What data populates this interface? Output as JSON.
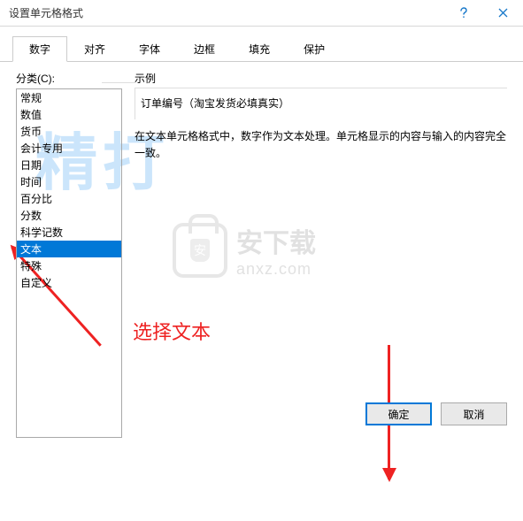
{
  "title": "设置单元格格式",
  "tabs": [
    "数字",
    "对齐",
    "字体",
    "边框",
    "填充",
    "保护"
  ],
  "active_tab": 0,
  "category_label": "分类(C):",
  "categories": [
    "常规",
    "数值",
    "货币",
    "会计专用",
    "日期",
    "时间",
    "百分比",
    "分数",
    "科学记数",
    "文本",
    "特殊",
    "自定义"
  ],
  "selected_index": 9,
  "sample_label": "示例",
  "sample_value": "订单编号（淘宝发货必填真实）",
  "description": "在文本单元格格式中，数字作为文本处理。单元格显示的内容与输入的内容完全一致。",
  "buttons": {
    "ok": "确定",
    "cancel": "取消"
  },
  "annotation": "选择文本",
  "watermark_cn": "精打",
  "watermark_brand": "安下载",
  "watermark_domain": "anxz.com"
}
